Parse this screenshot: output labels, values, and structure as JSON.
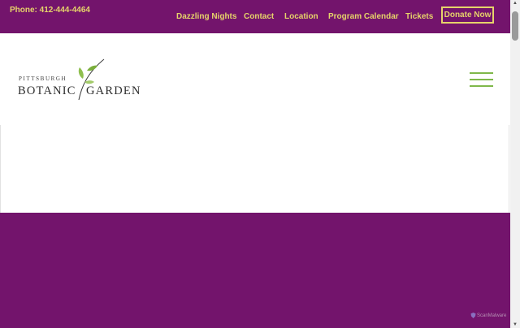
{
  "topbar": {
    "phone": "Phone: 412-444-4464",
    "nav": [
      "Dazzling Nights",
      "Contact",
      "Location",
      "Program Calendar",
      "Tickets"
    ],
    "donate_label": "Donate Now"
  },
  "logo": {
    "small_text": "PITTSBURGH",
    "big_left": "BOTANIC",
    "big_right": "GARDEN"
  },
  "footer_badge": "ScanMalware",
  "colors": {
    "brand_purple": "#73146c",
    "link_gold": "#e6d36a",
    "menu_green": "#7fb84a"
  }
}
